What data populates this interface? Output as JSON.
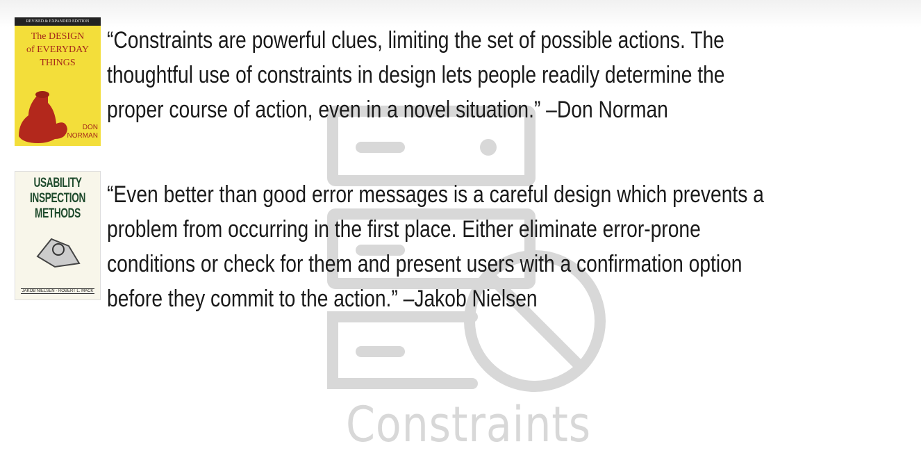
{
  "watermark": {
    "label": "Constraints",
    "icon": "server-blocked-icon",
    "color": "#d8d8d8"
  },
  "books": [
    {
      "band": "REVISED & EXPANDED EDITION",
      "title": [
        "The DESIGN",
        "of EVERYDAY",
        "THINGS"
      ],
      "author": [
        "DON",
        "NORMAN"
      ]
    },
    {
      "title": [
        "USABILITY",
        "INSPECTION",
        "METHODS"
      ],
      "editors": "JAKOB NIELSEN · ROBERT L. MACK"
    }
  ],
  "quotes": [
    {
      "lines": [
        "“Constraints are powerful clues, limiting the set of possible actions. The",
        "thoughtful use of constraints in design lets people readily determine the",
        "proper course of action, even in a novel situation.” –Don Norman"
      ]
    },
    {
      "lines": [
        "“Even better than good error messages is a careful design which prevents a",
        "problem from occurring in the first place. Either eliminate error-prone",
        "conditions or check for them and present users with a confirmation option",
        "before they commit to the action.” –Jakob Nielsen"
      ]
    }
  ]
}
